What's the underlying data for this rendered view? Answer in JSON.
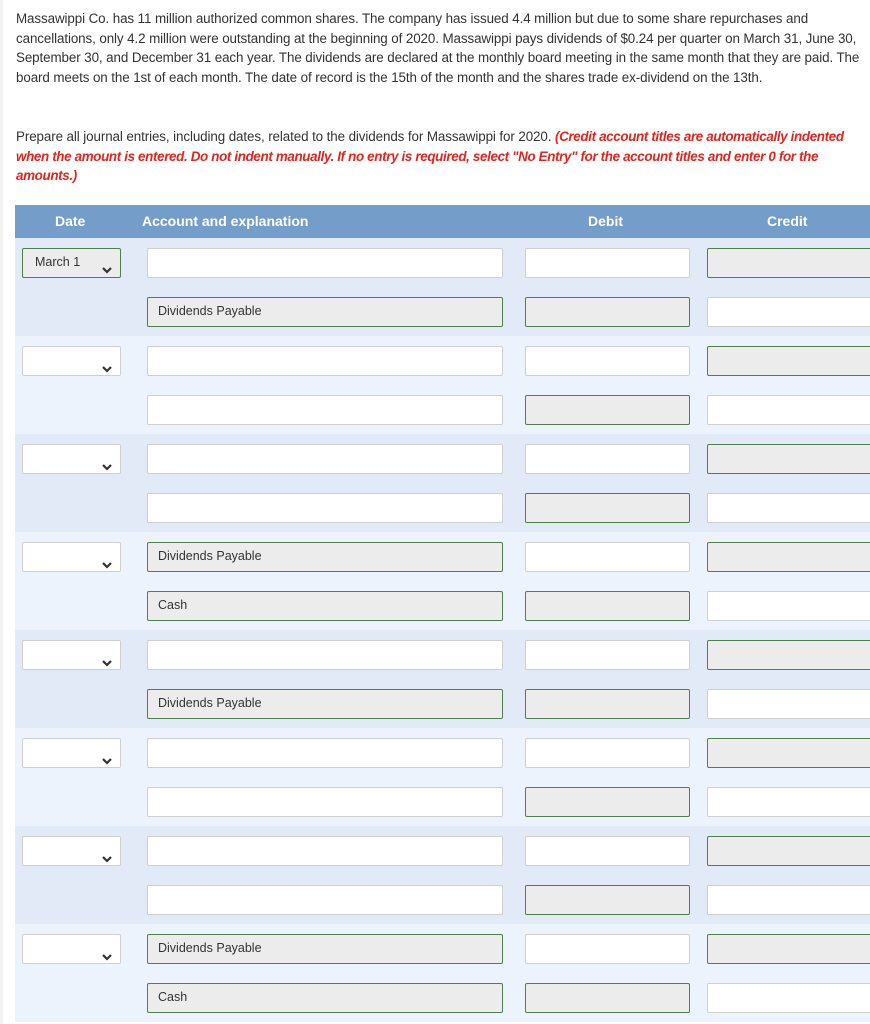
{
  "problem_text": "Massawippi Co. has 11 million authorized common shares. The company has issued 4.4 million but due to some share repurchases and cancellations, only 4.2 million were outstanding at the beginning of 2020. Massawippi pays dividends of $0.24 per quarter on March 31, June 30, September 30, and December 31 each year. The dividends are declared at the monthly board meeting in the same month that they are paid. The board meets on the 1st of each month. The date of record is the 15th of the month and the shares trade ex-dividend on the 13th.",
  "instructions": {
    "text": "Prepare all journal entries, including dates, related to the dividends for Massawippi for 2020. ",
    "note": "(Credit account titles are automatically indented when the amount is entered. Do not indent manually. If no entry is required, select \"No Entry\" for the account titles and enter 0 for the amounts.)"
  },
  "table": {
    "headers": {
      "date": "Date",
      "account": "Account and explanation",
      "debit": "Debit",
      "credit": "Credit"
    },
    "entries": [
      {
        "date": "March 1",
        "debit_account": "",
        "credit_account": "Dividends Payable",
        "debit_account_locked": false,
        "credit_account_locked": true
      },
      {
        "date": "",
        "debit_account": "",
        "credit_account": "",
        "debit_account_locked": false,
        "credit_account_locked": false
      },
      {
        "date": "",
        "debit_account": "",
        "credit_account": "",
        "debit_account_locked": false,
        "credit_account_locked": false
      },
      {
        "date": "",
        "debit_account": "Dividends Payable",
        "credit_account": "Cash",
        "debit_account_locked": true,
        "credit_account_locked": true
      },
      {
        "date": "",
        "debit_account": "",
        "credit_account": "Dividends Payable",
        "debit_account_locked": false,
        "credit_account_locked": true
      },
      {
        "date": "",
        "debit_account": "",
        "credit_account": "",
        "debit_account_locked": false,
        "credit_account_locked": false
      },
      {
        "date": "",
        "debit_account": "",
        "credit_account": "",
        "debit_account_locked": false,
        "credit_account_locked": false
      },
      {
        "date": "",
        "debit_account": "Dividends Payable",
        "credit_account": "Cash",
        "debit_account_locked": true,
        "credit_account_locked": true
      }
    ],
    "icons": {
      "date_dropdown": "chevron-down-icon"
    }
  },
  "colors": {
    "header_bg": "#749ec9",
    "row_dark": "#e1eaf6",
    "row_light": "#edf3fd",
    "locked_border": "#4f7f4a",
    "locked_bg": "#ececec",
    "instruction_red": "#e8231c"
  }
}
